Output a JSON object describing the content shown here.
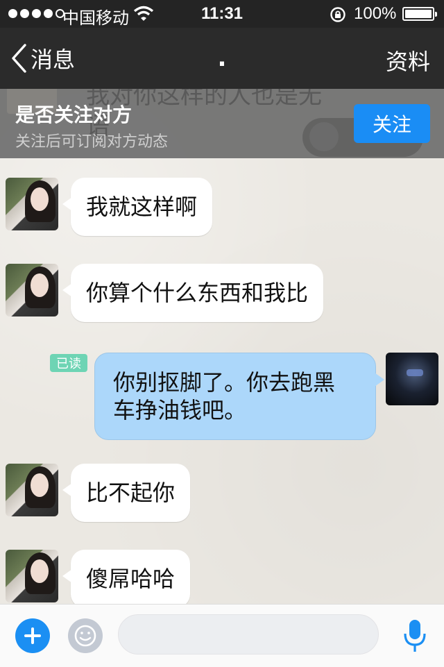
{
  "status_bar": {
    "carrier": "中国移动",
    "time": "11:31",
    "battery": "100%"
  },
  "nav": {
    "back_label": "消息",
    "title": ".",
    "profile_label": "资料"
  },
  "follow_banner": {
    "background_text": "我对你这样的人也是无语",
    "title": "是否关注对方",
    "subtitle": "关注后可订阅对方动态",
    "button_label": "关注"
  },
  "messages": [
    {
      "side": "received",
      "text": "我就这样啊"
    },
    {
      "side": "received",
      "text": "你算个什么东西和我比"
    },
    {
      "side": "sent",
      "read_label": "已读",
      "line1": "你别抠脚了。你去跑黑",
      "line2": "车挣油钱吧。"
    },
    {
      "side": "received",
      "text": "比不起你"
    },
    {
      "side": "received",
      "text": "傻屌哈哈"
    }
  ],
  "input": {
    "placeholder": ""
  },
  "colors": {
    "accent": "#1b8ff3",
    "sent_bubble": "#acd7fa",
    "read_badge": "#6ed4b4"
  },
  "icons": [
    "signal-icon",
    "wifi-icon",
    "rotation-lock-icon",
    "battery-icon",
    "chevron-left-icon",
    "plus-icon",
    "emoji-icon",
    "microphone-icon"
  ]
}
